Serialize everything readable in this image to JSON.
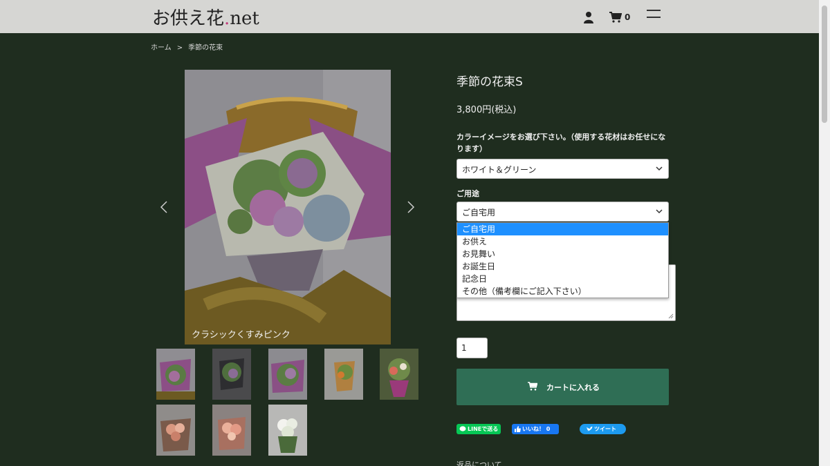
{
  "header": {
    "logo_part1": "お供え花",
    "logo_dot": ".",
    "logo_part2": "net",
    "cart_count": "0"
  },
  "breadcrumb": {
    "home": "ホーム",
    "separator": ">",
    "current": "季節の花束"
  },
  "gallery": {
    "caption": "クラシックくすみピンク",
    "thumb_count": 8
  },
  "product": {
    "title": "季節の花束S",
    "price": "3,800円(税込)",
    "color_label": "カラーイメージをお選び下さい。（使用する花材はお任せになります）",
    "color_selected": "ホワイト＆グリーン",
    "usage_label": "ご用途",
    "usage_selected": "ご自宅用",
    "usage_options": [
      "ご自宅用",
      "お供え",
      "お見舞い",
      "お誕生日",
      "記念日",
      "その他（備考欄にご記入下さい）"
    ],
    "quantity": "1",
    "cart_button": "カートに入れる"
  },
  "share": {
    "line": "LINEで送る",
    "facebook": "いいね！ 0",
    "twitter": "ツイート"
  },
  "footer": {
    "returns": "返品について"
  },
  "colors": {
    "background": "#1f2d1f",
    "header": "#d6d6d3",
    "cart_button": "#2f6e55",
    "dropdown_highlight": "#1e90ff",
    "line": "#06c755",
    "facebook": "#1877f2",
    "twitter": "#1d9bf0"
  }
}
